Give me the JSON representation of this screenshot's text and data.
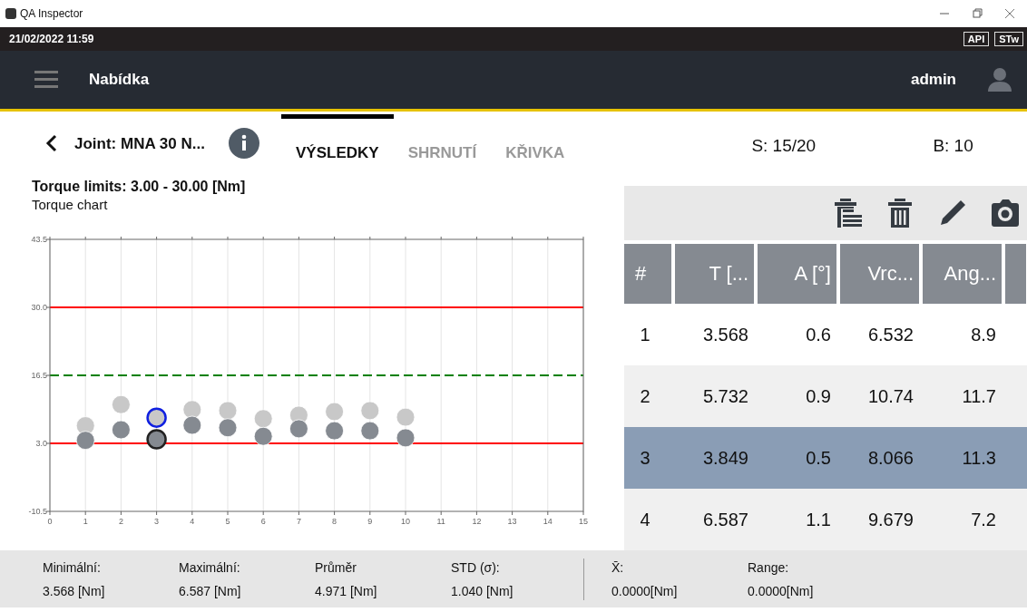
{
  "window": {
    "title": "QA Inspector"
  },
  "status_bar": {
    "datetime": "21/02/2022 11:59",
    "badges": [
      "API",
      "STw"
    ]
  },
  "header": {
    "menu_label": "Nabídka",
    "user": "admin"
  },
  "subheader": {
    "joint": "Joint: MNA 30 N...",
    "tabs": [
      {
        "label": "VÝSLEDKY",
        "selected": true
      },
      {
        "label": "SHRNUTÍ",
        "selected": false
      },
      {
        "label": "KŘIVKA",
        "selected": false
      }
    ],
    "sequence": "S: 15/20",
    "batch": "B: 10"
  },
  "chart_panel": {
    "limits": "Torque limits: 3.00 - 30.00 [Nm]",
    "subtitle": "Torque chart",
    "chart_data": {
      "type": "scatter",
      "x": [
        1,
        2,
        3,
        4,
        5,
        6,
        7,
        8,
        9,
        10
      ],
      "series": [
        {
          "color": "#c8c8c8",
          "values": [
            6.5,
            10.7,
            8.1,
            9.7,
            9.5,
            7.9,
            8.6,
            9.3,
            9.5,
            8.2
          ]
        },
        {
          "color": "#858a91",
          "values": [
            3.6,
            5.7,
            3.8,
            6.6,
            6.1,
            4.4,
            5.9,
            5.5,
            5.5,
            4.1
          ]
        }
      ],
      "grid": true,
      "xlim": [
        0,
        15
      ],
      "ylim": [
        -10.5,
        43.5
      ],
      "xticks": [
        0,
        1,
        2,
        3,
        4,
        5,
        6,
        7,
        8,
        9,
        10,
        11,
        12,
        13,
        14,
        15
      ],
      "yticks": [
        {
          "value": -10.5,
          "label": "-10.5"
        },
        {
          "value": 3,
          "label": "3.0"
        },
        {
          "value": 16.5,
          "label": "16.5"
        },
        {
          "value": 30,
          "label": "30.0"
        },
        {
          "value": 43.5,
          "label": "43.5"
        }
      ],
      "ref_lines": [
        {
          "axis": "y",
          "value": 30,
          "color": "#ff0000"
        },
        {
          "axis": "y",
          "value": 16.5,
          "color": "#008000"
        },
        {
          "axis": "y",
          "value": 3,
          "color": "#ff0000"
        }
      ]
    }
  },
  "table": {
    "columns": [
      "#",
      "T [...",
      "A [°]",
      "Vrc...",
      "Ang..."
    ],
    "rows": [
      {
        "cells": [
          "1",
          "3.568",
          "0.6",
          "6.532",
          "8.9"
        ],
        "selected": false
      },
      {
        "cells": [
          "2",
          "5.732",
          "0.9",
          "10.74",
          "11.7"
        ],
        "selected": false
      },
      {
        "cells": [
          "3",
          "3.849",
          "0.5",
          "8.066",
          "11.3"
        ],
        "selected": true
      },
      {
        "cells": [
          "4",
          "6.587",
          "1.1",
          "9.679",
          "7.2"
        ],
        "selected": false
      }
    ]
  },
  "stats": [
    {
      "label": "Minimální:",
      "value": "3.568 [Nm]"
    },
    {
      "label": "Maximální:",
      "value": "6.587 [Nm]"
    },
    {
      "label": "Průměr",
      "value": "4.971 [Nm]"
    },
    {
      "label": "STD (σ):",
      "value": "1.040 [Nm]"
    }
  ],
  "control_stats": [
    {
      "label": "X̄:",
      "value": "0.0000[Nm]"
    },
    {
      "label": "Range:",
      "value": "0.0000[Nm]"
    }
  ]
}
